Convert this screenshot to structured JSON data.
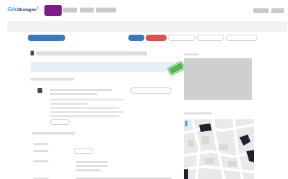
{
  "header": {
    "logo_geo": "Géo",
    "logo_bretagne": "Bretagne",
    "logo_mark": "®"
  },
  "colors": {
    "brand_purple": "#7b1f87",
    "primary_blue": "#3a78bf",
    "danger_red": "#d9534f",
    "ribbon_green": "#4cb84a",
    "highlight_row": "#e5f1f7"
  },
  "icons": {
    "ribbon": "tag-ribbon-icon",
    "record": "square-icon",
    "map": "map-icon"
  }
}
